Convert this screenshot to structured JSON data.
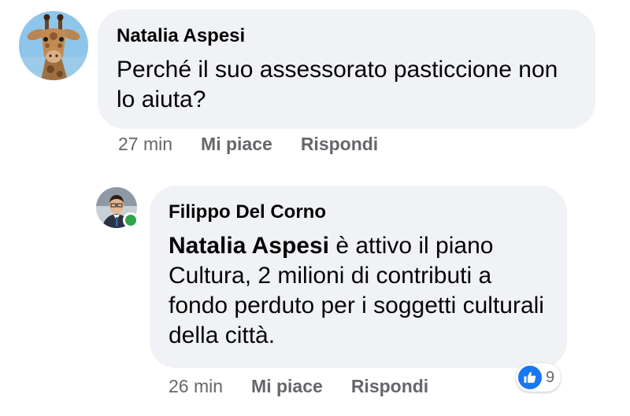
{
  "comments": [
    {
      "author": "Natalia Aspesi",
      "text": "Perché il suo assessorato pasticcione non lo aiuta?",
      "time": "27 min",
      "like_label": "Mi piace",
      "reply_label": "Rispondi",
      "avatar": "giraffe-avatar"
    }
  ],
  "reply": {
    "author": "Filippo Del Corno",
    "mention": "Natalia Aspesi",
    "text": " è attivo il piano Cultura, 2 milioni di contributi a fondo perduto per i soggetti culturali della città.",
    "time": "26 min",
    "like_label": "Mi piace",
    "reply_label": "Rispondi",
    "avatar": "person-avatar",
    "online": true,
    "reaction_icon": "like-icon",
    "reaction_count": "9"
  },
  "colors": {
    "bubble": "#f0f2f5",
    "meta_text": "#65676b",
    "like_blue": "#1877f2",
    "online_green": "#31a24c"
  }
}
